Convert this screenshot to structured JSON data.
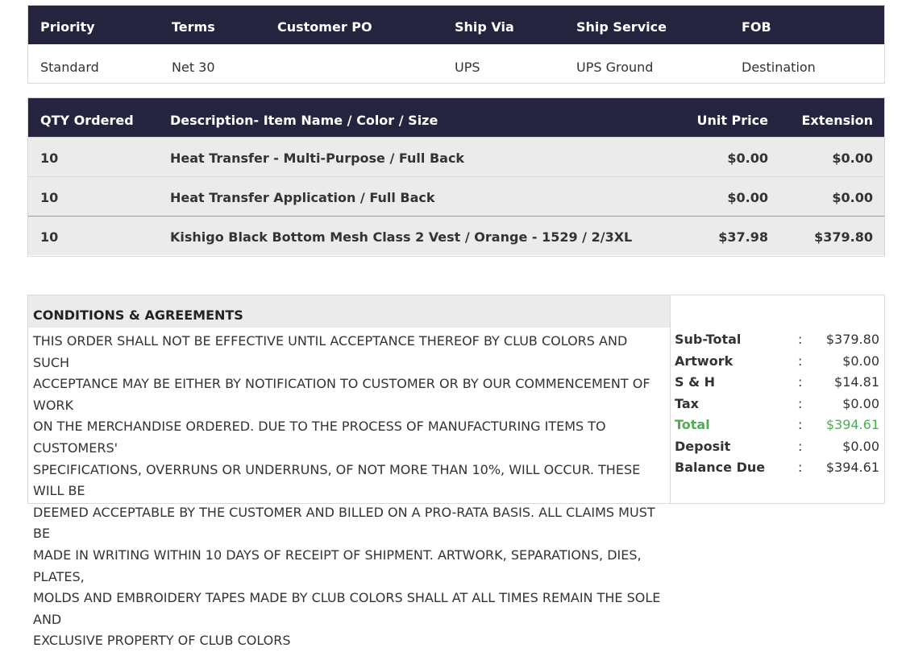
{
  "shipping": {
    "headers": [
      "Priority",
      "Terms",
      "Customer PO",
      "Ship Via",
      "Ship Service",
      "FOB"
    ],
    "values": [
      "Standard",
      "Net 30",
      "",
      "UPS",
      "UPS Ground",
      "Destination"
    ]
  },
  "items": {
    "headers": [
      "QTY Ordered",
      "Description- Item Name / Color / Size",
      "Unit Price",
      "Extension"
    ],
    "rows": [
      {
        "qty": "10",
        "description": "Heat Transfer - Multi-Purpose / Full Back",
        "unit_price": "$0.00",
        "extension": "$0.00"
      },
      {
        "qty": "10",
        "description": "Heat Transfer Application / Full Back",
        "unit_price": "$0.00",
        "extension": "$0.00"
      },
      {
        "qty": "10",
        "description": "Kishigo Black Bottom Mesh Class 2 Vest / Orange - 1529 / 2/3XL",
        "unit_price": "$37.98",
        "extension": "$379.80"
      }
    ]
  },
  "conditions": {
    "title": "CONDITIONS & AGREEMENTS",
    "lines": [
      "THIS ORDER SHALL NOT BE EFFECTIVE UNTIL ACCEPTANCE THEREOF BY CLUB COLORS AND SUCH",
      "ACCEPTANCE MAY BE EITHER BY NOTIFICATION TO CUSTOMER OR BY OUR COMMENCEMENT OF WORK",
      "ON THE MERCHANDISE ORDERED. DUE TO THE PROCESS OF MANUFACTURING ITEMS TO CUSTOMERS'",
      "SPECIFICATIONS, OVERRUNS OR UNDERRUNS, OF NOT MORE THAN 10%, WILL OCCUR. THESE WILL BE",
      "DEEMED ACCEPTABLE BY THE CUSTOMER AND BILLED ON A PRO-RATA BASIS. ALL CLAIMS MUST BE",
      "MADE IN WRITING WITHIN 10 DAYS OF RECEIPT OF SHIPMENT. ARTWORK, SEPARATIONS, DIES, PLATES,",
      "MOLDS AND EMBROIDERY TAPES MADE BY CLUB COLORS SHALL AT ALL TIMES REMAIN THE SOLE AND",
      "EXCLUSIVE PROPERTY OF CLUB COLORS"
    ]
  },
  "totals": {
    "separator": ":",
    "rows": [
      {
        "label": "Sub-Total",
        "value": "$379.80"
      },
      {
        "label": "Artwork",
        "value": "$0.00"
      },
      {
        "label": "S & H",
        "value": "$14.81"
      },
      {
        "label": "Tax",
        "value": "$0.00"
      },
      {
        "label": "Total",
        "value": "$394.61"
      },
      {
        "label": "Deposit",
        "value": "$0.00"
      },
      {
        "label": "Balance Due",
        "value": "$394.61"
      }
    ]
  },
  "colors": {
    "header_bg": "#24243f",
    "row_bg": "#ebebeb",
    "total_green": "#4caf50"
  }
}
